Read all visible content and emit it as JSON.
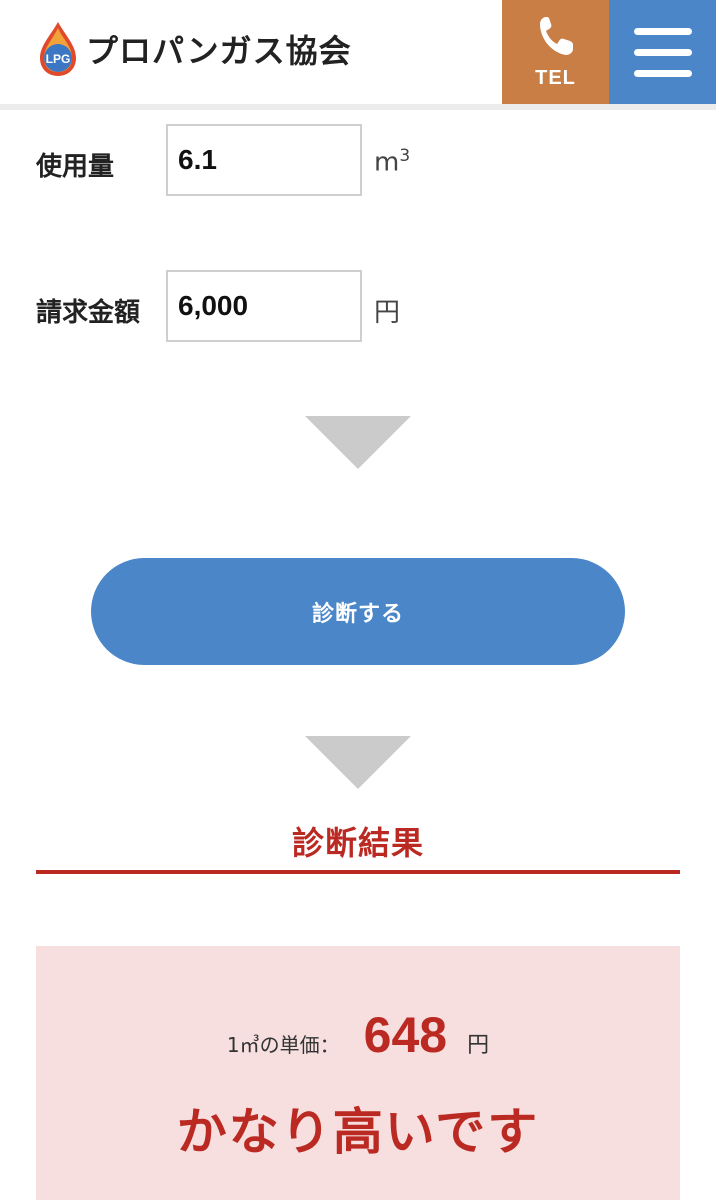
{
  "header": {
    "logo_text": "プロパンガス協会",
    "logo_badge": "LPG",
    "tel_label": "TEL"
  },
  "form": {
    "usage": {
      "label": "使用量",
      "value": "6.1",
      "unit": "m",
      "unit_sup": "3"
    },
    "billing": {
      "label": "請求金額",
      "value": "6,000",
      "unit": "円"
    }
  },
  "diagnose_button_label": "診断する",
  "result": {
    "title": "診断結果",
    "unit_price_label": "1㎥の単価：",
    "unit_price_value": "648",
    "unit_price_unit": "円",
    "verdict": "かなり高いです"
  },
  "colors": {
    "tel_bg": "#c87e45",
    "menu_bg": "#4a86c8",
    "button_bg": "#4a86c8",
    "accent_red": "#bb2a22",
    "result_bg": "#f7dfe0",
    "arrow": "#cbcbcb"
  },
  "icons": {
    "logo": "flame-drop-icon",
    "tel": "phone-icon",
    "menu": "hamburger-menu-icon",
    "step_arrow": "triangle-down-icon"
  }
}
